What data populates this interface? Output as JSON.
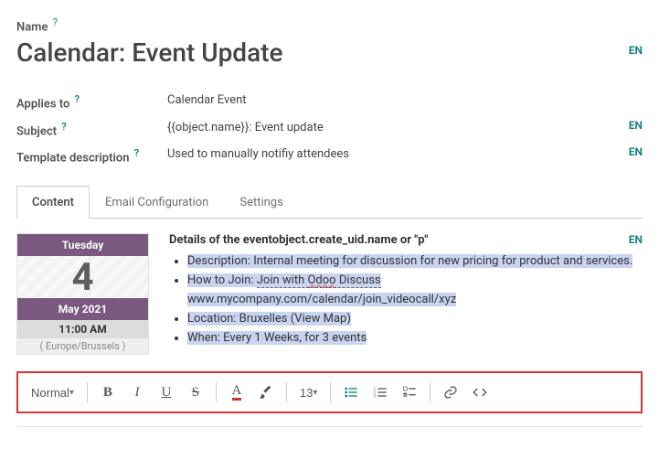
{
  "labels": {
    "name": "Name",
    "applies_to": "Applies to",
    "subject": "Subject",
    "template_description": "Template description"
  },
  "values": {
    "name": "Calendar: Event Update",
    "applies_to": "Calendar Event",
    "subject": "{{object.name}}: Event update",
    "template_description": "Used to manually notifiy attendees"
  },
  "lang": {
    "code": "EN"
  },
  "tabs": [
    {
      "id": "content",
      "label": "Content",
      "active": true
    },
    {
      "id": "email_config",
      "label": "Email Configuration",
      "active": false
    },
    {
      "id": "settings",
      "label": "Settings",
      "active": false
    }
  ],
  "calendar": {
    "dow": "Tuesday",
    "day": "4",
    "month_year": "May 2021",
    "time": "11:00 AM",
    "timezone": "( Europe/Brussels )"
  },
  "details": {
    "heading": "Details of the eventobject.create_uid.name or \"p\"",
    "items": {
      "desc_label": "Description: ",
      "desc_body": "Internal meeting for discussion for new pricing for product and services.",
      "how_label": "How to Join: ",
      "how_line1a": "Join with ",
      "how_line1b": "Odoo",
      "how_line1c": " Discuss",
      "how_line2": "www.mycompany.com/calendar/join_videocall/xyz",
      "loc_label": "Location: ",
      "loc_body": "Bruxelles (View Map)",
      "when_label": "When: ",
      "when_body": "Every 1 Weeks, for 3 events"
    }
  },
  "toolbar": {
    "style_label": "Normal",
    "size_label": "13"
  }
}
